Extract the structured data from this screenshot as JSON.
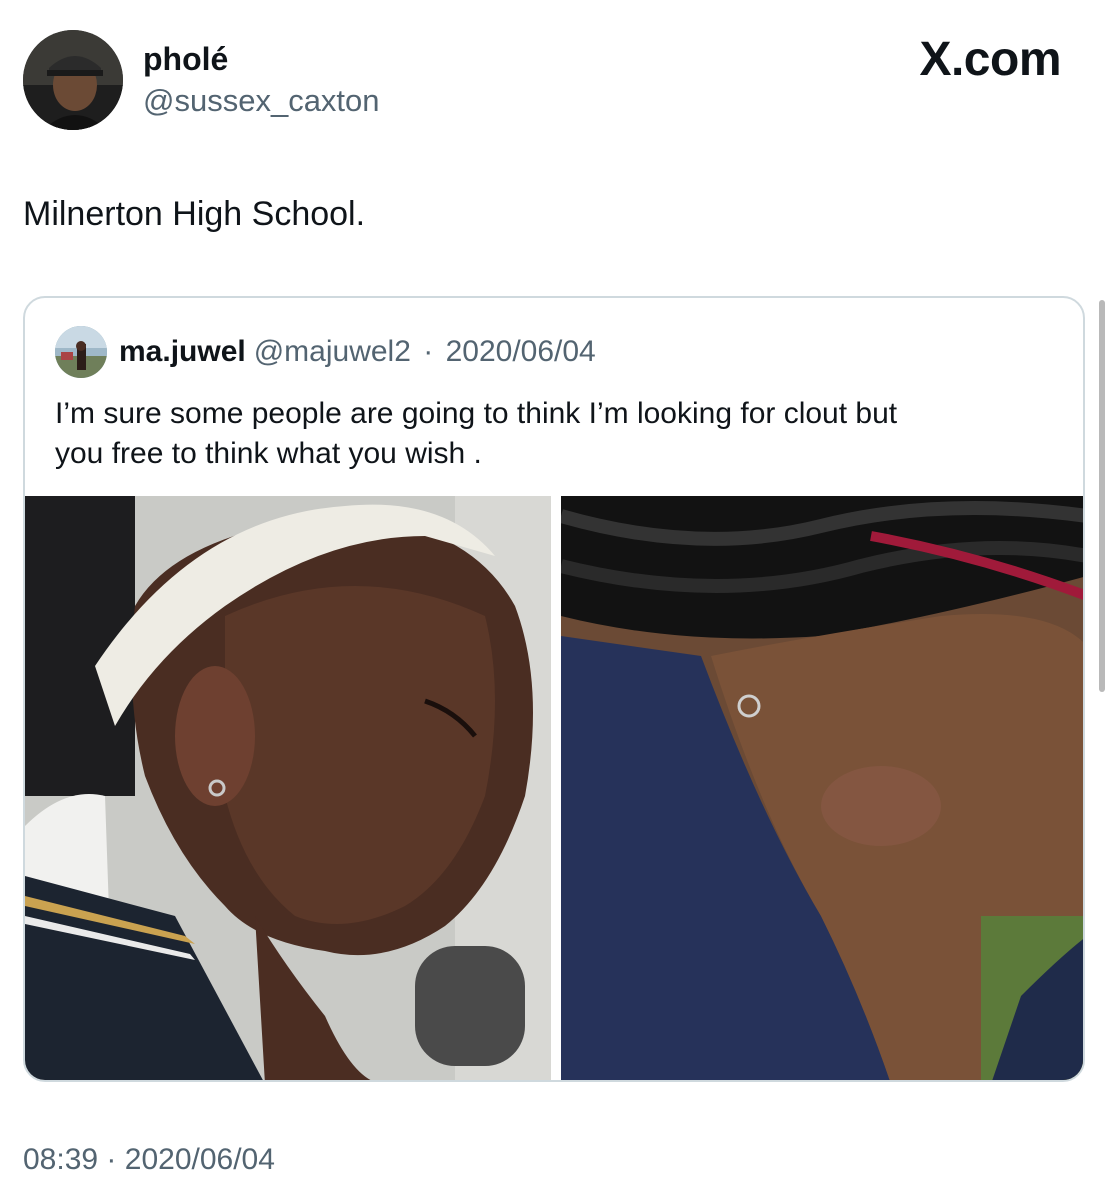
{
  "author": {
    "display_name": "pholé",
    "handle": "@sussex_caxton"
  },
  "brand": {
    "label": "X.com"
  },
  "tweet": {
    "text": "Milnerton High School.",
    "time": "08:39",
    "separator": "·",
    "date": "2020/06/04"
  },
  "quoted_tweet": {
    "display_name": "ma.juwel",
    "handle": "@majuwel2",
    "separator": "·",
    "date": "2020/06/04",
    "text_line_1": "I’m sure some people are going to think I’m looking for clout but",
    "text_line_2": "you free to think what you wish ."
  },
  "colors": {
    "text_primary": "#0f1419",
    "text_secondary": "#536471",
    "border": "#cfd9de"
  },
  "icons": {
    "avatar": "profile-photo-icon",
    "quoted_avatar": "profile-photo-icon"
  }
}
